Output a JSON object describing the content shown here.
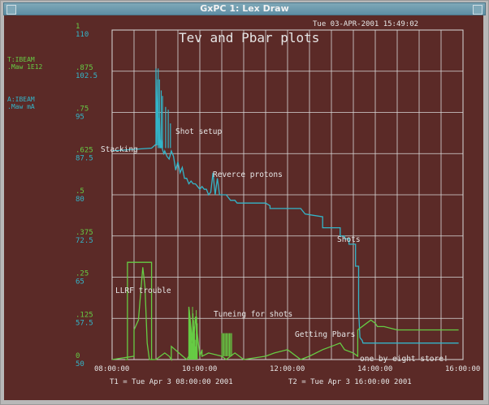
{
  "window": {
    "title": "GxPC 1: Lex Draw"
  },
  "plot": {
    "title": "Tev and Pbar plots",
    "timestamp": "Tue 03-APR-2001 15:49:02",
    "t1_label": "T1 = Tue Apr  3 08:00:00 2001",
    "t2_label": "T2 = Tue Apr  3 16:00:00 2001",
    "legend_green": {
      "name": "T:IBEAM",
      "units": ".Maw    1E12"
    },
    "legend_cyan": {
      "name": "A:IBEAM",
      "units": ".Maw    mA"
    },
    "colors": {
      "background": "#5b2a27",
      "grid": "#d9d9d9",
      "green": "#66cc44",
      "cyan": "#33b5c9",
      "text": "#e6e6e6"
    },
    "annotations": [
      {
        "text": "Stacking"
      },
      {
        "text": "Shot setup"
      },
      {
        "text": "Reverce protons"
      },
      {
        "text": "Shots"
      },
      {
        "text": "LLRF trouble"
      },
      {
        "text": "Tuneing for shots"
      },
      {
        "text": "Getting Pbars"
      },
      {
        "text": "one by eight store!"
      }
    ]
  },
  "chart_data": {
    "type": "line",
    "title": "Tev and Pbar plots",
    "x_ticks": [
      "08:00:00",
      "10:00:00",
      "12:00:00",
      "14:00:00",
      "16:00:00"
    ],
    "xlim": [
      8,
      16
    ],
    "y_left_green_ticks": [
      "1",
      ".875",
      ".75",
      ".625",
      ".5",
      ".375",
      ".25",
      ".125",
      "0"
    ],
    "y_left_cyan_ticks": [
      "110",
      "102.5",
      "95",
      "87.5",
      "80",
      "72.5",
      "65",
      "57.5",
      "50"
    ],
    "ylim_green": [
      0,
      1
    ],
    "ylim_cyan": [
      50,
      110
    ],
    "grid": true,
    "series": [
      {
        "name": "A:IBEAM",
        "color": "#33b5c9",
        "axis": "cyan",
        "x": [
          8.0,
          8.9,
          8.9,
          9.0,
          9.0,
          9.02,
          9.04,
          9.06,
          9.08,
          9.1,
          9.12,
          9.14,
          9.16,
          9.18,
          9.2,
          9.25,
          9.3,
          9.35,
          9.4,
          9.45,
          9.5,
          9.55,
          9.6,
          9.65,
          9.7,
          9.75,
          9.8,
          9.85,
          9.9,
          9.95,
          10.0,
          10.05,
          10.1,
          10.15,
          10.2,
          10.25,
          10.3,
          10.35,
          10.4,
          10.45,
          10.5,
          10.55,
          10.6,
          10.65,
          10.7,
          10.75,
          10.8,
          10.85,
          10.9,
          10.95,
          11.0,
          11.5,
          11.6,
          11.6,
          12.3,
          12.4,
          12.4,
          12.8,
          12.8,
          13.2,
          13.2,
          13.3,
          13.3,
          13.4,
          13.4,
          13.55,
          13.55,
          13.62,
          13.62,
          13.65,
          13.7,
          13.72,
          13.75,
          13.8,
          13.85,
          13.9,
          13.95,
          14.0,
          14.1,
          14.2,
          14.5,
          15.0,
          15.5,
          15.9
        ],
        "y": [
          88.0,
          88.5,
          88.5,
          89.2,
          103,
          89,
          101,
          89,
          94,
          88.5,
          90,
          88.5,
          88,
          87.5,
          88,
          87,
          86.5,
          88,
          87,
          84.5,
          86,
          84,
          85,
          83,
          83,
          82,
          82.5,
          82,
          82,
          81.5,
          81,
          81.5,
          81,
          81,
          80,
          80.5,
          84,
          80,
          83,
          80,
          80,
          80,
          80,
          79.5,
          79,
          79,
          79,
          78.5,
          78.5,
          78.5,
          78.5,
          78.5,
          78,
          77.5,
          77.5,
          76.5,
          76.5,
          76,
          74,
          74,
          72.5,
          72.5,
          72,
          72,
          71,
          71,
          67,
          67,
          59,
          54,
          53.5,
          53,
          53,
          53,
          53,
          53,
          53,
          53,
          53,
          53,
          53,
          53,
          53,
          53
        ]
      },
      {
        "name": "T:IBEAM",
        "color": "#66cc44",
        "axis": "green",
        "x": [
          8.0,
          8.5,
          8.5,
          8.6,
          8.7,
          8.75,
          8.8,
          8.85,
          9.0,
          9.1,
          9.2,
          9.3,
          9.35,
          9.35,
          9.7,
          9.75,
          9.75,
          9.85,
          9.9,
          10.0,
          10.05,
          10.05,
          10.2,
          10.5,
          10.6,
          10.7,
          10.8,
          10.9,
          11.0,
          11.5,
          11.7,
          12.0,
          12.3,
          12.5,
          12.8,
          13.0,
          13.2,
          13.3,
          13.5,
          13.6,
          13.6,
          13.8,
          13.9,
          14.0,
          14.05,
          14.2,
          14.5,
          15.0,
          15.9
        ],
        "y": [
          0.0,
          0.01,
          0.09,
          0.12,
          0.28,
          0.22,
          0.05,
          0.0,
          0.0,
          0.01,
          0.02,
          0.01,
          0.0,
          0.04,
          0.0,
          0.01,
          0.16,
          0.03,
          0.13,
          0.01,
          0.03,
          0.01,
          0.02,
          0.01,
          0.0,
          0.01,
          0.02,
          0.01,
          0.0,
          0.01,
          0.02,
          0.03,
          0.0,
          0.01,
          0.03,
          0.04,
          0.05,
          0.03,
          0.02,
          0.01,
          0.09,
          0.11,
          0.12,
          0.11,
          0.1,
          0.1,
          0.09,
          0.09,
          0.09
        ]
      },
      {
        "name": "LLRF trouble",
        "color": "#66cc44",
        "axis": "green",
        "x": [
          8.3,
          8.35,
          8.35,
          8.9,
          8.9,
          8.95
        ],
        "y": [
          0.0,
          0.0,
          0.295,
          0.295,
          0.0,
          0.0
        ]
      }
    ]
  }
}
